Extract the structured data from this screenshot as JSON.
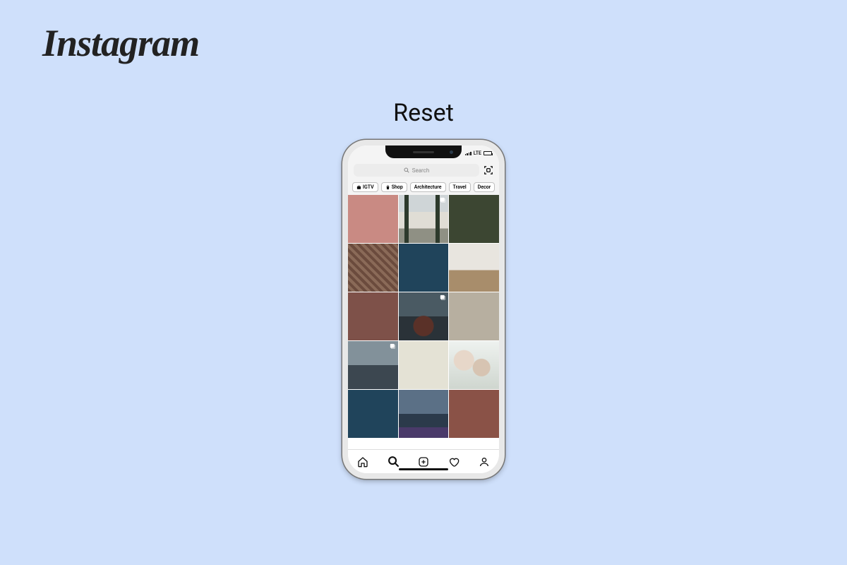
{
  "brand": "Instagram",
  "headline": "Reset",
  "status": {
    "network": "LTE"
  },
  "search": {
    "placeholder": "Search"
  },
  "chips": [
    {
      "label": "IGTV",
      "icon": "tv"
    },
    {
      "label": "Shop",
      "icon": "bag"
    },
    {
      "label": "Architecture"
    },
    {
      "label": "Travel"
    },
    {
      "label": "Decor"
    }
  ],
  "grid": [
    {
      "kind": "pink",
      "carousel": false
    },
    {
      "kind": "arch",
      "carousel": true
    },
    {
      "kind": "green",
      "carousel": false
    },
    {
      "kind": "stair",
      "carousel": false
    },
    {
      "kind": "navy",
      "carousel": false
    },
    {
      "kind": "room",
      "carousel": false
    },
    {
      "kind": "brown",
      "carousel": false
    },
    {
      "kind": "temple",
      "carousel": true
    },
    {
      "kind": "tan",
      "carousel": false
    },
    {
      "kind": "train",
      "carousel": true
    },
    {
      "kind": "cream",
      "carousel": false
    },
    {
      "kind": "flower",
      "carousel": false
    },
    {
      "kind": "navy",
      "carousel": false
    },
    {
      "kind": "storm",
      "carousel": false
    },
    {
      "kind": "rust",
      "carousel": false
    }
  ],
  "nav": {
    "home": "home",
    "search": "search",
    "add": "add",
    "activity": "activity",
    "profile": "profile",
    "active": "search"
  }
}
